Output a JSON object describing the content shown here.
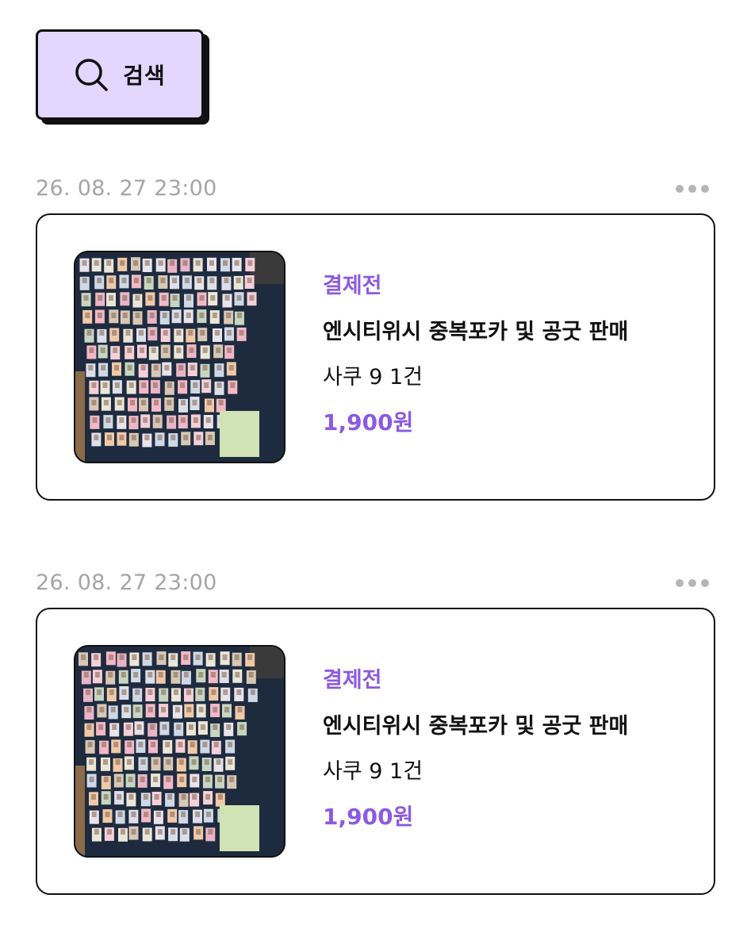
{
  "search": {
    "label": "검색",
    "background": "#e3d6ff"
  },
  "colors": {
    "accent": "#8c5ae0",
    "date_gray": "#a5a5a5",
    "border": "#111111"
  },
  "orders": [
    {
      "date": "26. 08. 27 23:00",
      "more_icon": "more-horizontal-icon",
      "status": "결제전",
      "title": "엔시티위시 중복포카 및 공굿 판매",
      "meta": "사쿠 9 1건",
      "price": "1,900원"
    },
    {
      "date": "26. 08. 27 23:00",
      "more_icon": "more-horizontal-icon",
      "status": "결제전",
      "title": "엔시티위시 중복포카 및 공굿 판매",
      "meta": "사쿠 9 1건",
      "price": "1,900원"
    }
  ]
}
